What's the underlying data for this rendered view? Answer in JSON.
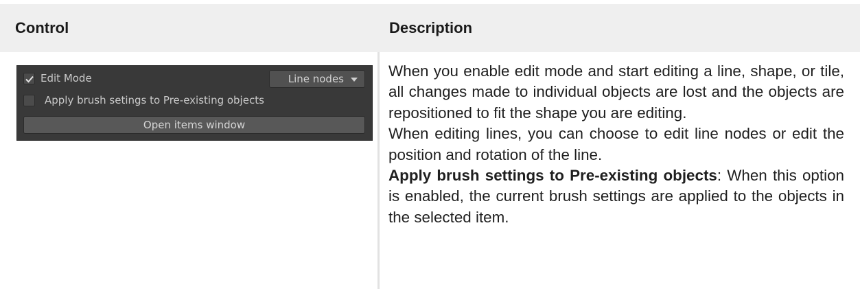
{
  "table": {
    "headers": {
      "control": "Control",
      "description": "Description"
    }
  },
  "panel": {
    "edit_mode_label": "Edit Mode",
    "edit_mode_checked": true,
    "dropdown_value": "Line nodes",
    "apply_label": "Apply brush setings to Pre-existing objects",
    "apply_checked": false,
    "open_button": "Open items window"
  },
  "description": {
    "p1": "When you enable edit mode and start editing a line, shape, or tile, all changes made to individual objects are lost and the objects are repositioned to fit the shape you are editing.",
    "p2": "When editing lines, you can choose to edit line nodes or edit the position and rotation of the line.",
    "p3_bold": "Apply brush settings to Pre-existing objects",
    "p3_rest": ": When this option is enabled, the current brush settings are applied to the objects in the selected item."
  }
}
